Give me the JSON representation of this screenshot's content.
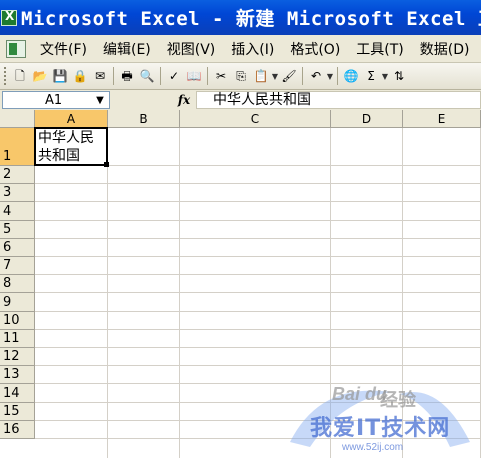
{
  "window": {
    "title": "Microsoft Excel - 新建 Microsoft Excel 工作表"
  },
  "menu": {
    "items": [
      "文件(F)",
      "编辑(E)",
      "视图(V)",
      "插入(I)",
      "格式(O)",
      "工具(T)",
      "数据(D)"
    ]
  },
  "toolbar": {
    "buttons": [
      {
        "name": "new-icon",
        "glyph": "🗋"
      },
      {
        "name": "open-icon",
        "glyph": "📂"
      },
      {
        "name": "save-icon",
        "glyph": "💾"
      },
      {
        "name": "permission-icon",
        "glyph": "🔒"
      },
      {
        "name": "email-icon",
        "glyph": "✉"
      },
      {
        "name": "print-icon",
        "glyph": "🖶"
      },
      {
        "name": "print-preview-icon",
        "glyph": "🔍"
      },
      {
        "name": "spelling-icon",
        "glyph": "✓"
      },
      {
        "name": "research-icon",
        "glyph": "📖"
      },
      {
        "name": "cut-icon",
        "glyph": "✂"
      },
      {
        "name": "copy-icon",
        "glyph": "⎘"
      },
      {
        "name": "paste-icon",
        "glyph": "📋"
      },
      {
        "name": "format-painter-icon",
        "glyph": "🖌"
      },
      {
        "name": "undo-icon",
        "glyph": "↶"
      },
      {
        "name": "hyperlink-icon",
        "glyph": "🌐"
      },
      {
        "name": "autosum-icon",
        "glyph": "Σ"
      },
      {
        "name": "sort-ascending-icon",
        "glyph": "⇅"
      }
    ]
  },
  "formula_bar": {
    "name_box": "A1",
    "fx_label": "fx",
    "content": "中华人民共和国"
  },
  "sheet": {
    "columns": [
      "A",
      "B",
      "C",
      "D",
      "E"
    ],
    "rows": [
      "1",
      "2",
      "3",
      "4",
      "5",
      "6",
      "7",
      "8",
      "9",
      "10",
      "11",
      "12",
      "13",
      "14",
      "15",
      "16"
    ],
    "active_cell": "A1",
    "cells": {
      "A1": "中华人民共和国"
    }
  },
  "watermark": {
    "baidu": "Bai du",
    "jingyan": "经验",
    "site_cn": "我爱IT技术网",
    "site_url": "www.52ij.com"
  }
}
